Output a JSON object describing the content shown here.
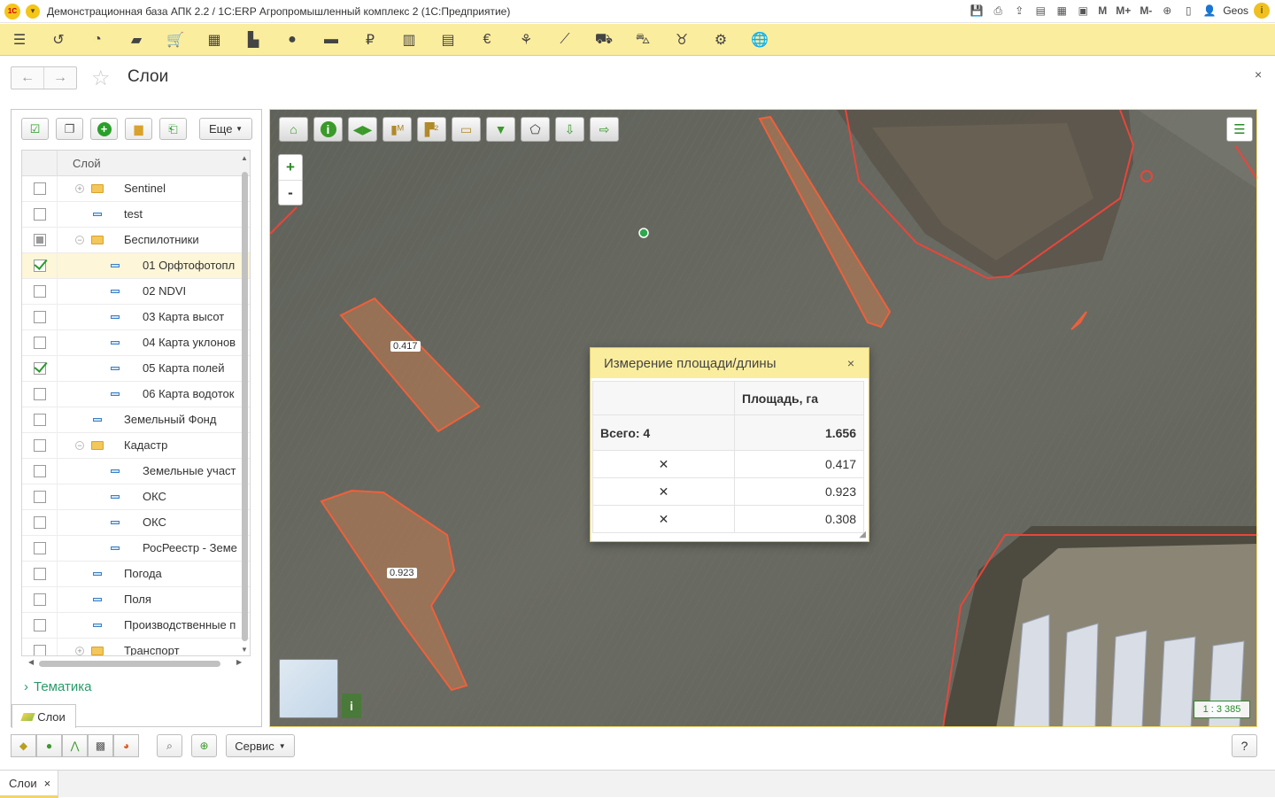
{
  "titlebar": {
    "logo": "1С",
    "title": "Демонстрационная база АПК 2.2 / 1С:ERP Агропромышленный комплекс 2   (1С:Предприятие)",
    "m": "M",
    "m_plus": "M+",
    "m_minus": "M-",
    "user": "Geos",
    "icons": [
      "save-icon",
      "print-icon",
      "upload-icon",
      "print-preview-icon",
      "calculator-icon",
      "calendar-icon",
      "zoom-icon",
      "panels-icon",
      "user-icon",
      "info-icon"
    ]
  },
  "sections": {
    "icons": [
      "menu-icon",
      "history-icon",
      "pie-icon",
      "bag-icon",
      "cart-icon",
      "grid-icon",
      "factory-icon",
      "person-icon",
      "money-icon",
      "ruble-icon",
      "bar-chart-icon",
      "calculator-icon",
      "euro-icon",
      "wheat-icon",
      "chart-icon",
      "truck-icon",
      "tractor-icon",
      "cow-icon",
      "gear-icon",
      "globe-icon"
    ]
  },
  "header": {
    "title": "Слои",
    "back": "←",
    "forward": "→",
    "close": "×"
  },
  "layers": {
    "more_button": "Еще",
    "column_header": "Слой",
    "rows": [
      {
        "label": "Sentinel",
        "checked": false
      },
      {
        "label": "test",
        "checked": false
      },
      {
        "label": "Беспилотники",
        "checked": "partial"
      },
      {
        "label": "01 Орфтофотопл",
        "checked": true
      },
      {
        "label": "02 NDVI",
        "checked": false
      },
      {
        "label": "03 Карта высот",
        "checked": false
      },
      {
        "label": "04 Карта уклонов",
        "checked": false
      },
      {
        "label": "05 Карта полей",
        "checked": true
      },
      {
        "label": "06 Карта водоток",
        "checked": false
      },
      {
        "label": "Земельный Фонд",
        "checked": false
      },
      {
        "label": "Кадастр",
        "checked": false
      },
      {
        "label": "Земельные участ",
        "checked": false
      },
      {
        "label": "ОКС",
        "checked": false
      },
      {
        "label": "ОКС",
        "checked": false
      },
      {
        "label": "РосРеестр - Земе",
        "checked": false
      },
      {
        "label": "Погода",
        "checked": false
      },
      {
        "label": "Поля",
        "checked": false
      },
      {
        "label": "Производственные п",
        "checked": false
      },
      {
        "label": "Транспорт",
        "checked": false
      }
    ],
    "tematika": "Тематика",
    "tab": "Слои"
  },
  "map": {
    "plus": "+",
    "minus": "-",
    "info": "i",
    "scale": "1 : 3 385",
    "polygon_labels": [
      "0.417",
      "0.923"
    ],
    "outline_color": "#e8463a"
  },
  "dialog": {
    "title": "Измерение площади/длины",
    "close": "×",
    "col_header": "Площадь, га",
    "total_label": "Всего: 4",
    "total_value": "1.656",
    "rows": [
      {
        "remove": "✕",
        "value": "0.417"
      },
      {
        "remove": "✕",
        "value": "0.923"
      },
      {
        "remove": "✕",
        "value": "0.308"
      }
    ]
  },
  "bottom": {
    "servis": "Сервис",
    "help": "?"
  },
  "windows": {
    "tab": "Слои",
    "close": "×"
  }
}
